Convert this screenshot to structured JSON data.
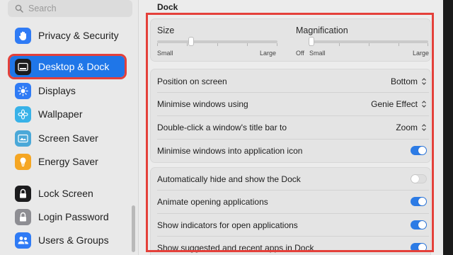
{
  "search": {
    "placeholder": "Search"
  },
  "sidebar": {
    "items": [
      {
        "label": "Privacy & Security",
        "icon": "hand-icon",
        "color": "#2f7bf5"
      },
      {
        "label": "Desktop & Dock",
        "icon": "dock-icon",
        "color": "#1c1c1e",
        "selected": true
      },
      {
        "label": "Displays",
        "icon": "sun-icon",
        "color": "#2f7bf5"
      },
      {
        "label": "Wallpaper",
        "icon": "flower-icon",
        "color": "#38b2e8"
      },
      {
        "label": "Screen Saver",
        "icon": "screen-saver-icon",
        "color": "#4aa8d8"
      },
      {
        "label": "Energy Saver",
        "icon": "bulb-icon",
        "color": "#f5a623"
      },
      {
        "label": "Lock Screen",
        "icon": "lock-icon",
        "color": "#1c1c1e"
      },
      {
        "label": "Login Password",
        "icon": "padlock-icon",
        "color": "#8e8e93"
      },
      {
        "label": "Users & Groups",
        "icon": "users-icon",
        "color": "#2f7bf5"
      }
    ]
  },
  "dock": {
    "title": "Dock",
    "size": {
      "label": "Size",
      "min_label": "Large",
      "small_label": "Small",
      "value": 0.28
    },
    "magnification": {
      "label": "Magnification",
      "off_label": "Off",
      "small_label": "Small",
      "large_label": "Large",
      "value": 0.04
    },
    "rows": [
      {
        "label": "Position on screen",
        "value": "Bottom"
      },
      {
        "label": "Minimise windows using",
        "value": "Genie Effect"
      },
      {
        "label": "Double-click a window's title bar to",
        "value": "Zoom"
      },
      {
        "label": "Minimise windows into application icon",
        "toggle": true
      }
    ],
    "toggles": [
      {
        "label": "Automatically hide and show the Dock",
        "on": false
      },
      {
        "label": "Animate opening applications",
        "on": true
      },
      {
        "label": "Show indicators for open applications",
        "on": true
      },
      {
        "label": "Show suggested and recent apps in Dock",
        "on": true
      }
    ]
  },
  "colors": {
    "accent": "#2c7be5",
    "highlight": "#e4403a"
  }
}
